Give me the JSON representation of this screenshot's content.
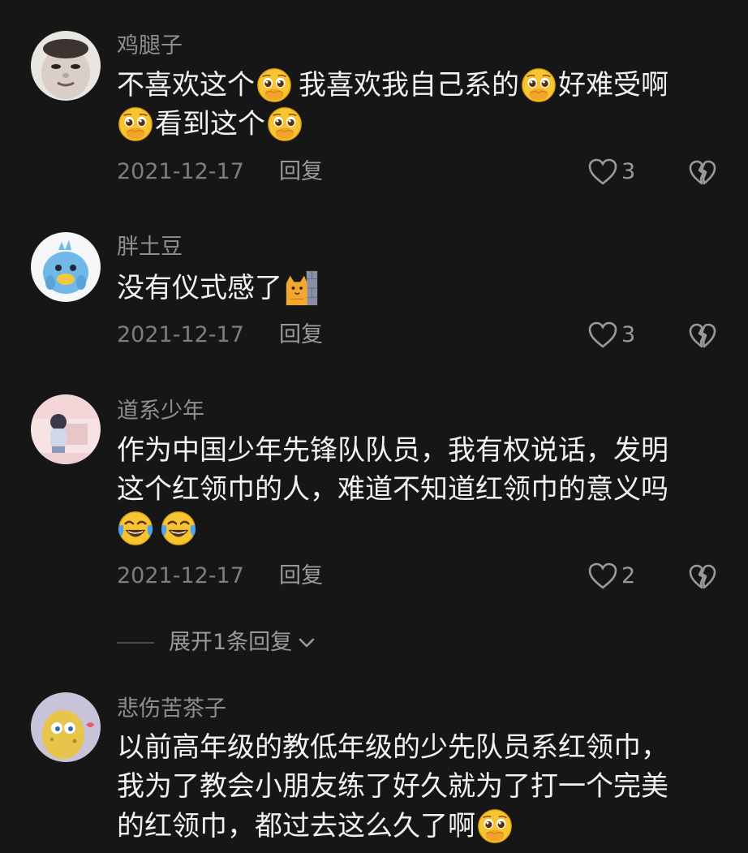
{
  "comments": [
    {
      "username": "鸡腿子",
      "body_segments": {
        "l1a": "不喜欢这个",
        "l1b": "我喜欢我自己系的",
        "l1c": "好难受啊",
        "l2a": "看到这个"
      },
      "date": "2021-12-17",
      "reply_label": "回复",
      "likes": "3"
    },
    {
      "username": "胖土豆",
      "body_segments": {
        "l1a": "没有仪式感了"
      },
      "date": "2021-12-17",
      "reply_label": "回复",
      "likes": "3"
    },
    {
      "username": "道系少年",
      "body_segments": {
        "l1a": "作为中国少年先锋队队员，我有权说话，发明",
        "l2a": "这个红领巾的人，难道不知道红领巾的意义吗"
      },
      "date": "2021-12-17",
      "reply_label": "回复",
      "likes": "2",
      "expand_label": "展开1条回复"
    },
    {
      "username": "悲伤苦茶子",
      "body_segments": {
        "l1a": "以前高年级的教低年级的少先队员系红领巾，",
        "l2a": "我为了教会小朋友练了好久就为了打一个完美",
        "l3a": "的红领巾，都过去这么久了啊"
      }
    }
  ],
  "icons": {
    "like": "heart-outline-icon",
    "dislike": "broken-heart-icon",
    "expand": "chevron-down-icon",
    "emoji_pleading": "pleading-face-emoji",
    "emoji_crying_laughing": "tears-of-joy-emoji",
    "emoji_peek": "cat-peeking-wall-emoji"
  },
  "colors": {
    "background": "#161616",
    "username": "#8f8f8f",
    "body_text": "#f2f2f2",
    "meta": "#7e7e7e"
  }
}
